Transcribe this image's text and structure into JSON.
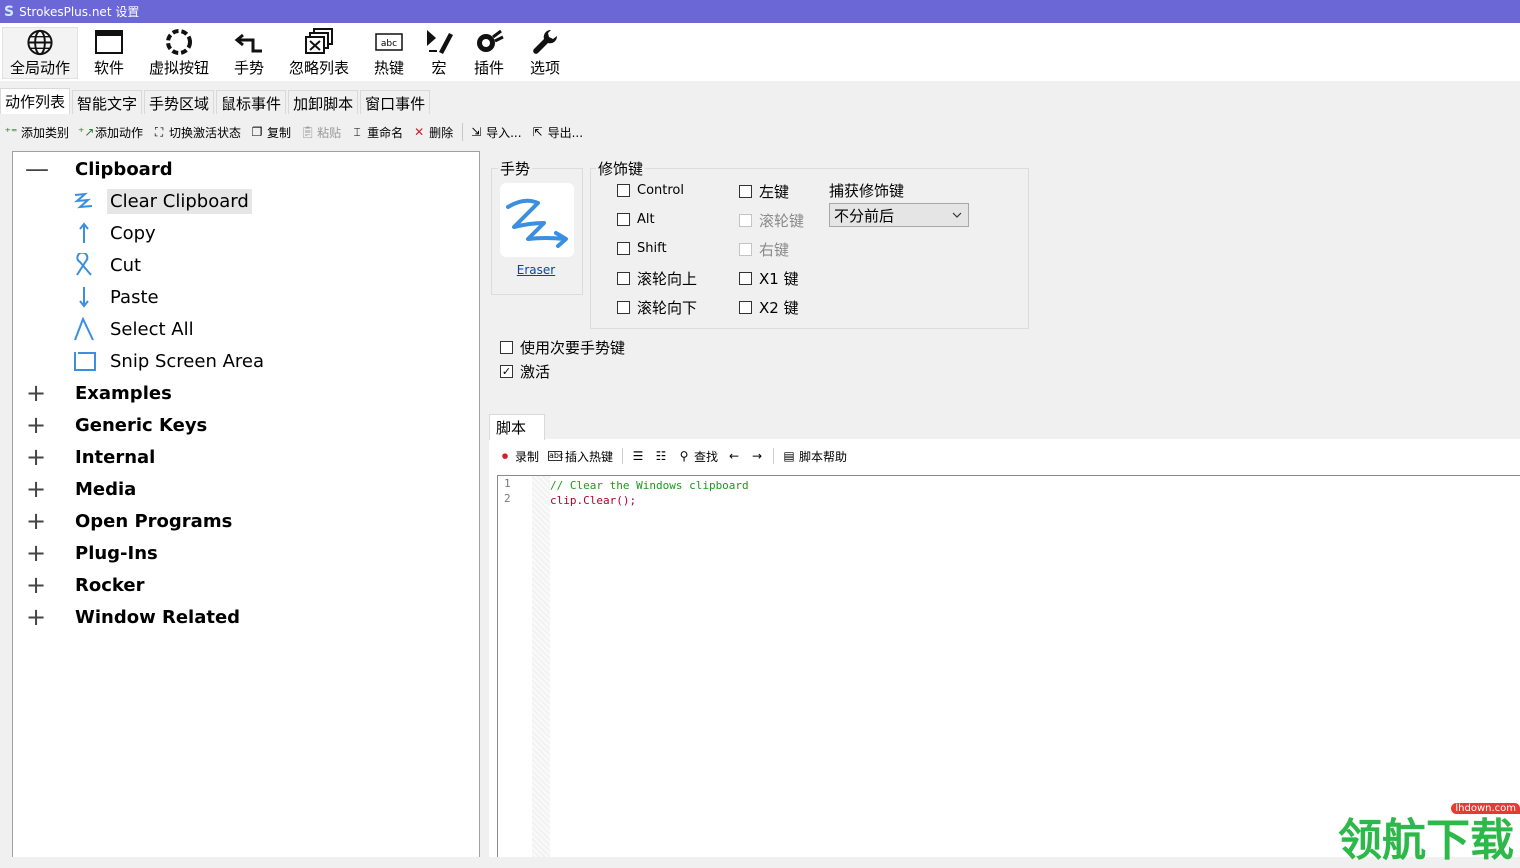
{
  "window": {
    "title": "StrokesPlus.net 设置",
    "logo": "S"
  },
  "toolbar": [
    {
      "label": "全局动作",
      "icon": "globe-icon"
    },
    {
      "label": "软件",
      "icon": "window-icon"
    },
    {
      "label": "虚拟按钮",
      "icon": "ring-icon"
    },
    {
      "label": "手势",
      "icon": "gesture-arrow-icon"
    },
    {
      "label": "忽略列表",
      "icon": "ignore-windows-icon"
    },
    {
      "label": "热键",
      "icon": "hotkey-icon"
    },
    {
      "label": "宏",
      "icon": "macro-icon"
    },
    {
      "label": "插件",
      "icon": "plugin-icon"
    },
    {
      "label": "选项",
      "icon": "wrench-icon"
    }
  ],
  "tabs": [
    "动作列表",
    "智能文字",
    "手势区域",
    "鼠标事件",
    "加卸脚本",
    "窗口事件"
  ],
  "actions": {
    "add_category": "添加类别",
    "add_action": "添加动作",
    "toggle_active": "切换激活状态",
    "copy": "复制",
    "paste": "粘贴",
    "rename": "重命名",
    "delete": "删除",
    "import": "导入...",
    "export": "导出..."
  },
  "tree": {
    "expanded_category": "Clipboard",
    "children": [
      "Clear Clipboard",
      "Copy",
      "Cut",
      "Paste",
      "Select All",
      "Snip Screen Area"
    ],
    "categories": [
      "Examples",
      "Generic Keys",
      "Internal",
      "Media",
      "Open Programs",
      "Plug-Ins",
      "Rocker",
      "Window Related"
    ],
    "expand_collapsed": "+",
    "expand_open": "—"
  },
  "gesture": {
    "title": "手势",
    "name": "Eraser"
  },
  "modifiers": {
    "title": "修饰键",
    "control": "Control",
    "alt": "Alt",
    "shift": "Shift",
    "wheel_up": "滚轮向上",
    "wheel_down": "滚轮向下",
    "left": "左键",
    "wheel": "滚轮键",
    "right": "右键",
    "x1": "X1 键",
    "x2": "X2 键",
    "capture_title": "捕获修饰键",
    "capture_value": "不分前后"
  },
  "options": {
    "secondary": "使用次要手势键",
    "active": "激活",
    "check_mark": "✓"
  },
  "script": {
    "tab": "脚本",
    "record": "录制",
    "insert_hotkey": "插入热键",
    "find": "查找",
    "help": "脚本帮助",
    "line_numbers": [
      "1",
      "2"
    ],
    "line1": "// Clear the Windows clipboard",
    "line2_obj": "clip",
    "line2_rest": ".Clear();"
  },
  "watermark": {
    "text": "领航下载",
    "badge": "lhdown.com"
  },
  "colors": {
    "titlebar": "#6b67d6",
    "accent": "#3a8fe0",
    "comment": "#1a9b1a",
    "code": "#b0002a"
  }
}
